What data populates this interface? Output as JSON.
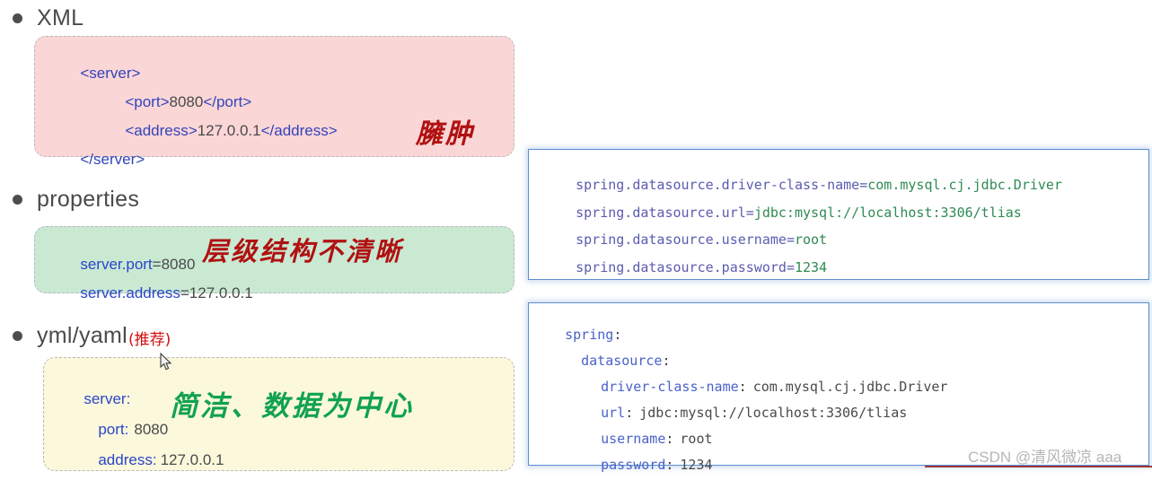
{
  "sections": [
    {
      "id": "xml",
      "label": "XML",
      "suffix": "",
      "annotation": "臃肿",
      "annotation_color": "#b01111",
      "card_color": "#fbd6d6",
      "lines": [
        {
          "indent": 0,
          "tag_open": "<server>",
          "value": "",
          "tag_close": ""
        },
        {
          "indent": 1,
          "tag_open": "<port>",
          "value": "8080",
          "tag_close": "</port>"
        },
        {
          "indent": 1,
          "tag_open": "<address>",
          "value": "127.0.0.1",
          "tag_close": "</address>"
        },
        {
          "indent": 0,
          "tag_open": "</server>",
          "value": "",
          "tag_close": ""
        }
      ]
    },
    {
      "id": "properties",
      "label": "properties",
      "suffix": "",
      "annotation": "层级结构不清晰",
      "annotation_color": "#b01111",
      "card_color": "#c9e9d3",
      "lines": [
        {
          "key": "server.port",
          "sep": "=",
          "value": "8080"
        },
        {
          "key": "server.address",
          "sep": "=",
          "value": "127.0.0.1"
        }
      ]
    },
    {
      "id": "yml",
      "label": "yml/yaml",
      "suffix": "(推荐)",
      "annotation": "简洁、数据为中心",
      "annotation_color": "#11a24f",
      "card_color": "#fbf8dc",
      "lines": [
        {
          "key": "server",
          "sep": ":",
          "value": ""
        },
        {
          "key": "port",
          "sep": ":",
          "value": "8080"
        },
        {
          "key": "address",
          "sep": ":",
          "value": "127.0.0.1"
        }
      ]
    }
  ],
  "properties_panel": {
    "lines": [
      {
        "key": "spring.datasource.driver-class-name",
        "sep": "=",
        "value": "com.mysql.cj.jdbc.Driver"
      },
      {
        "key": "spring.datasource.url",
        "sep": "=",
        "value": "jdbc:mysql://localhost:3306/tlias"
      },
      {
        "key": "spring.datasource.username",
        "sep": "=",
        "value": "root"
      },
      {
        "key": "spring.datasource.password",
        "sep": "=",
        "value": "1234"
      }
    ]
  },
  "yaml_panel": {
    "lines": [
      {
        "indent": 0,
        "key": "spring",
        "sep": ":",
        "value": ""
      },
      {
        "indent": 1,
        "key": "datasource",
        "sep": ":",
        "value": ""
      },
      {
        "indent": 2,
        "key": "driver-class-name",
        "sep": ":",
        "value": "com.mysql.cj.jdbc.Driver"
      },
      {
        "indent": 2,
        "key": "url",
        "sep": ":",
        "value": "jdbc:mysql://localhost:3306/tlias"
      },
      {
        "indent": 2,
        "key": "username",
        "sep": ":",
        "value": "root"
      },
      {
        "indent": 2,
        "key": "password",
        "sep": ":",
        "value": "1234"
      }
    ]
  },
  "watermark": {
    "text": "CSDN @清风微凉 aaa"
  },
  "colors": {
    "accent_blue": "#5b8fd0",
    "tag_blue": "#3344bb",
    "key_blue": "#2b46c8",
    "mono_key": "#5b5bb0",
    "mono_value": "#2f8a54",
    "yaml_key": "#4a62c8",
    "annot_red": "#b01111",
    "annot_green": "#11a24f",
    "heading": "#4a4a4a",
    "bottom_rule": "#9e3a3a"
  }
}
